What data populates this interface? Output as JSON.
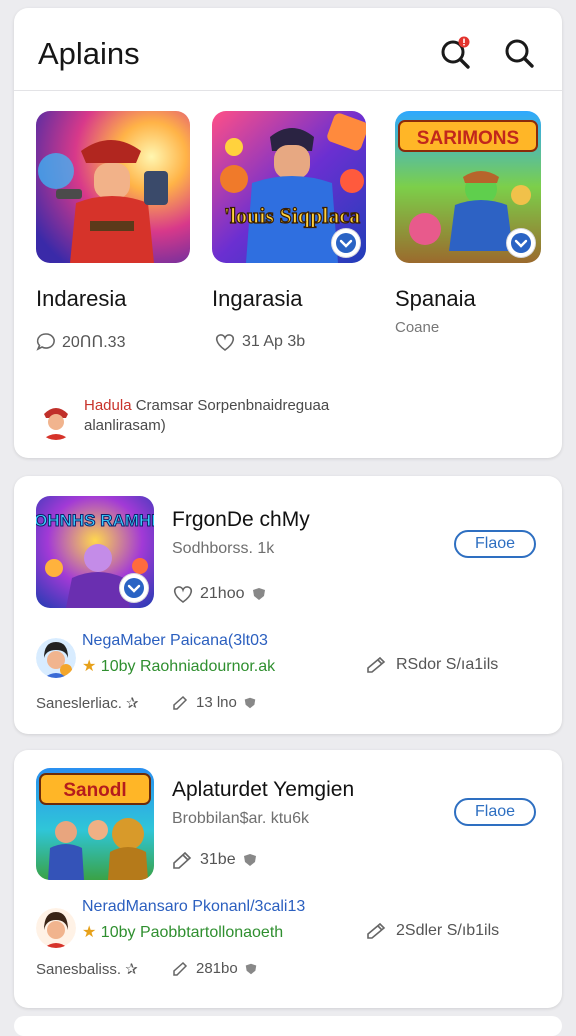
{
  "header": {
    "title": "Aplains"
  },
  "featured": [
    {
      "title": "Indaresia",
      "subtitle": "",
      "stat": "20ՈՈ.33"
    },
    {
      "title": "Ingarasia",
      "subtitle": "",
      "stat": "31 Ap 3b"
    },
    {
      "title": "Spanaia",
      "subtitle": "Coane",
      "stat": ""
    }
  ],
  "featured_art_text": {
    "g2": "'louis Siqplaca",
    "g3": "SARIMONS"
  },
  "news": {
    "highlight": "Hadula",
    "line1": "Cramsar Sorpenbnaidreguaa",
    "line2": "alanlirasam)"
  },
  "feed": [
    {
      "art_text": "SHOHNHS RAMHIER",
      "title": "FrgonDe chMy",
      "subtitle": "Sodhborss. 1k",
      "button": "Flaoe",
      "stat": "21hoo",
      "line_blue": "NegaMaber Paicana(3lt03",
      "line_green": "10by Raohniadournor.ak",
      "right_stat": "RSdor S/ıa1ils",
      "foot_left": "Saneslerliac. ✰",
      "foot_right": "13 lno"
    },
    {
      "art_text": "Sanodl",
      "title": "Aplaturdet Yemgien",
      "subtitle": "Brobbilan$ar. ktu6k",
      "button": "Flaoe",
      "stat": "31be",
      "line_blue": "NeradMansaro Pkonanl/3cali13",
      "line_green": "10by Paobbtartollonaoeth",
      "right_stat": "2Sdler S/ıb1ils",
      "foot_left": "Sanesbaliss. ✰",
      "foot_right": "281bo"
    }
  ]
}
